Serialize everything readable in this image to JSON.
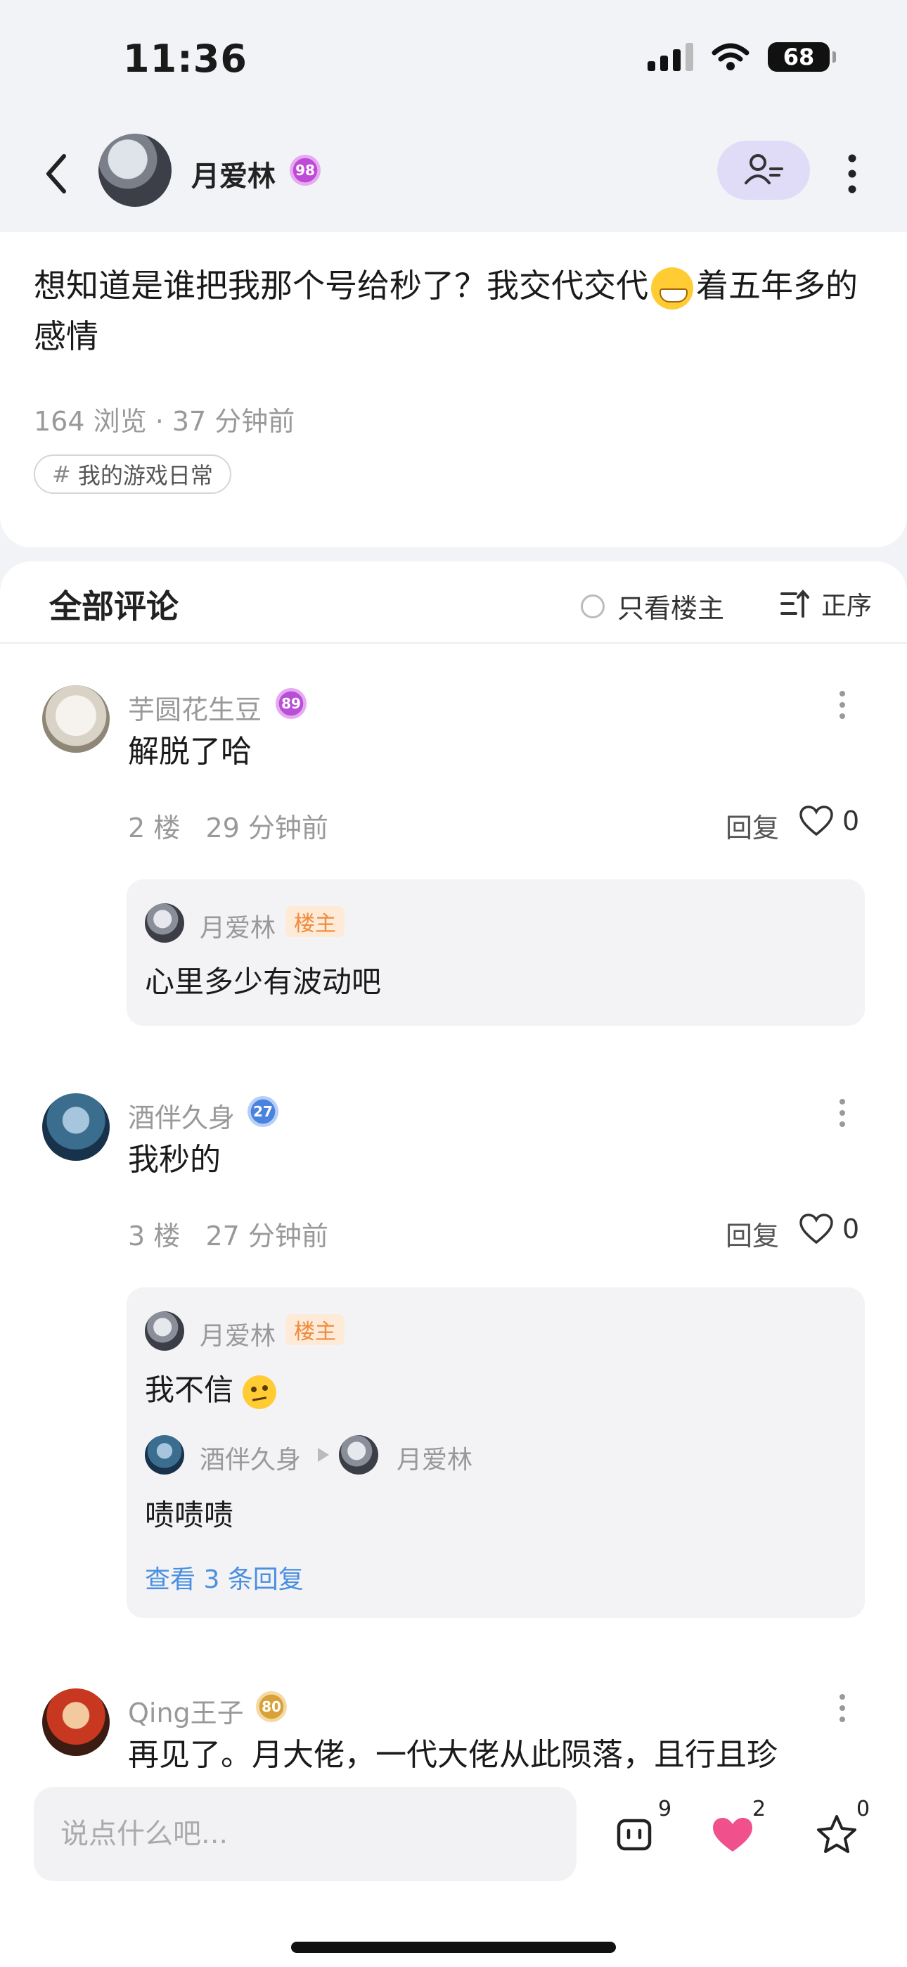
{
  "status_bar": {
    "time": "11:36",
    "battery": "68"
  },
  "nav": {
    "author_name": "月爱林",
    "author_level": "98"
  },
  "post": {
    "text_before_emoji": "想知道是谁把我那个号给秒了？我交代交代",
    "text_after_emoji": "着五年多的感情",
    "views_and_time": "164 浏览 · 37 分钟前",
    "tag": "我的游戏日常",
    "tag_prefix": "#"
  },
  "comments_header": {
    "title": "全部评论",
    "only_op_label": "只看楼主",
    "sort_label": "正序"
  },
  "comments": [
    {
      "name": "芋圆花生豆",
      "level": "89",
      "text": "解脱了哈",
      "floor_time": "2 楼   29 分钟前",
      "reply_label": "回复",
      "likes": "0",
      "replies": [
        {
          "name": "月爱林",
          "op_tag": "楼主",
          "text": "心里多少有波动吧"
        }
      ]
    },
    {
      "name": "酒伴久身",
      "level": "27",
      "text": "我秒的",
      "floor_time": "3 楼   27 分钟前",
      "reply_label": "回复",
      "likes": "0",
      "replies": [
        {
          "name": "月爱林",
          "op_tag": "楼主",
          "text": "我不信"
        },
        {
          "name": "酒伴久身",
          "to_name": "月爱林",
          "text": "啧啧啧"
        }
      ],
      "view_more": "查看 3 条回复"
    },
    {
      "name": "Qing王子",
      "level": "80",
      "text": "再见了。月大佬，一代大佬从此陨落，且行且珍"
    }
  ],
  "bottom_bar": {
    "input_placeholder": "说点什么吧...",
    "comment_count": "9",
    "like_count": "2",
    "favorite_count": "0"
  },
  "colors": {
    "accent_purple": "#e0dcf7",
    "op_tag_orange": "#f08a3c",
    "link_blue": "#4a8fe0",
    "heart_pink": "#f0508c"
  }
}
